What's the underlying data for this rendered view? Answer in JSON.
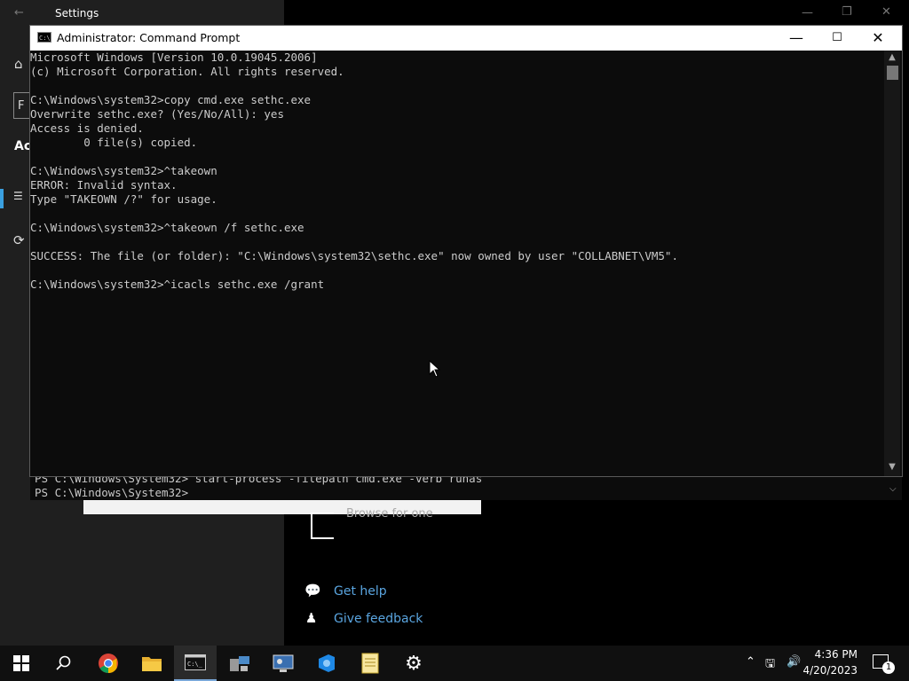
{
  "settings": {
    "title": "Settings",
    "section_partial": "Ac",
    "search_partial": "F",
    "browse_text": "Browse for one",
    "help": {
      "label": "Get help",
      "icon": "chat-help-icon"
    },
    "feedback": {
      "label": "Give feedback",
      "icon": "feedback-person-icon"
    }
  },
  "powershell": {
    "lines": [
      "PS C:\\Windows\\System32> start-process -filepath cmd.exe -verb runas",
      "PS C:\\Windows\\System32>"
    ]
  },
  "cmd": {
    "title": "Administrator: Command Prompt",
    "lines": [
      "Microsoft Windows [Version 10.0.19045.2006]",
      "(c) Microsoft Corporation. All rights reserved.",
      "",
      "C:\\Windows\\system32>copy cmd.exe sethc.exe",
      "Overwrite sethc.exe? (Yes/No/All): yes",
      "Access is denied.",
      "        0 file(s) copied.",
      "",
      "C:\\Windows\\system32>^takeown",
      "ERROR: Invalid syntax.",
      "Type \"TAKEOWN /?\" for usage.",
      "",
      "C:\\Windows\\system32>^takeown /f sethc.exe",
      "",
      "SUCCESS: The file (or folder): \"C:\\Windows\\system32\\sethc.exe\" now owned by user \"COLLABNET\\VM5\".",
      "",
      "C:\\Windows\\system32>^icacls sethc.exe /grant"
    ]
  },
  "taskbar": {
    "apps": [
      {
        "name": "start-button",
        "icon": "windows-logo-icon"
      },
      {
        "name": "search-button",
        "icon": "search-icon"
      },
      {
        "name": "chrome-app",
        "icon": "chrome-icon"
      },
      {
        "name": "file-explorer-app",
        "icon": "folder-icon"
      },
      {
        "name": "cmd-app",
        "icon": "terminal-icon",
        "active": true
      },
      {
        "name": "network-app",
        "icon": "network-computer-icon"
      },
      {
        "name": "remote-desktop-app",
        "icon": "remote-desktop-icon"
      },
      {
        "name": "app-blue",
        "icon": "azure-devops-icon"
      },
      {
        "name": "notepad-app",
        "icon": "notepad-icon"
      },
      {
        "name": "settings-app",
        "icon": "gear-icon"
      }
    ],
    "time": "4:36 PM",
    "date": "4/20/2023",
    "notification_count": "1"
  }
}
